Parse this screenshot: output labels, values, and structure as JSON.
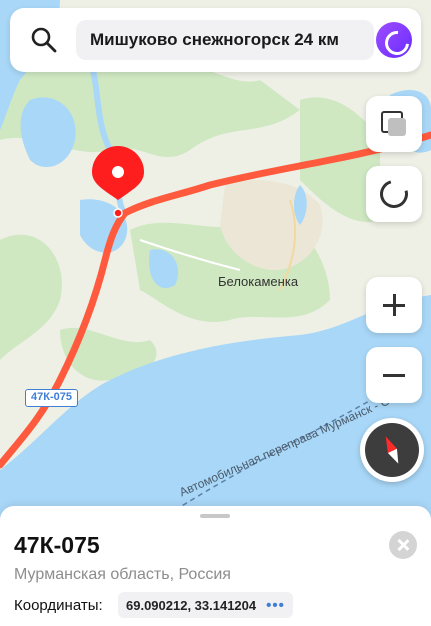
{
  "search": {
    "query": "Мишуково снежногорск 24 км"
  },
  "map": {
    "road_badge": "47К-075",
    "place_label": "Белокаменка",
    "road_label": "Автомобильная переправа Мурманск - Остров",
    "colors": {
      "water": "#a9d7f7",
      "land": "#eef0e6",
      "forest": "#cfe8c2",
      "route": "#ff5a3d",
      "pin": "#ff1e1e"
    }
  },
  "controls": {
    "layers_icon": "layers-icon",
    "mode_icon": "ring-icon",
    "zoom_in_icon": "plus-icon",
    "zoom_out_icon": "minus-icon",
    "compass_icon": "compass-icon"
  },
  "sheet": {
    "title": "47К-075",
    "subtitle": "Мурманская область, Россия",
    "coords_label": "Координаты:",
    "coords_value": "69.090212, 33.141204",
    "more": "•••"
  }
}
